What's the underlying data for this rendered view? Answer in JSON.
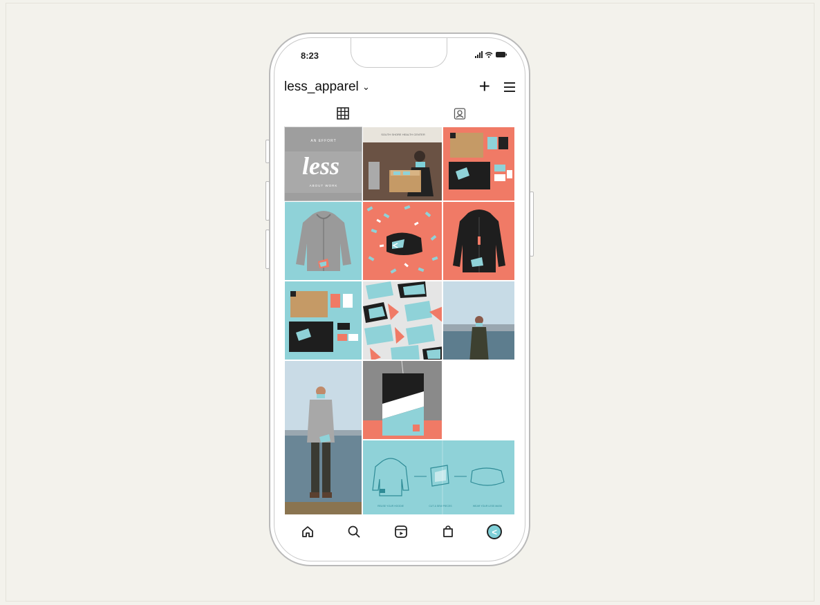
{
  "status_bar": {
    "time": "8:23",
    "icons": "📶 ⌔ ▭"
  },
  "profile": {
    "username": "less_apparel",
    "chevron": "⌄"
  },
  "header_actions": {
    "plus": "+"
  },
  "tabs": [
    "grid-icon",
    "tagged-icon"
  ],
  "cover_text": {
    "top": "AN EFFORT",
    "logo": "less",
    "bottom": "ABOUT WORK"
  },
  "poster_text": "SOUTH SHORE HEALTH CENTER",
  "caption_labels": [
    "REUSE YOUR HOODIE",
    "CUT & SEW PIECES",
    "WEAR YOUR LESS MASK"
  ],
  "colors": {
    "teal": "#8fd2d8",
    "coral": "#f07a66",
    "black": "#1e1e1e",
    "background": "#f3f2ec"
  },
  "nav": [
    "home-icon",
    "search-icon",
    "reels-icon",
    "shop-icon",
    "profile-avatar"
  ],
  "avatar_glyph": "<"
}
